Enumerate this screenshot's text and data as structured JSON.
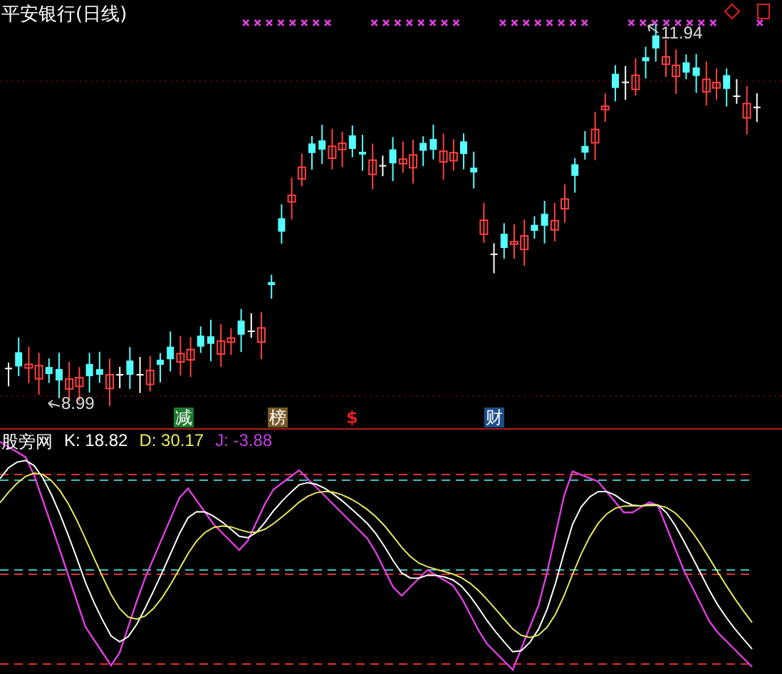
{
  "chart_title": "平安银行(日线)",
  "high_label": "11.94",
  "low_label": "8.99",
  "signals": [
    {
      "text": "减",
      "kind": "badge",
      "color": "#1e7a2e"
    },
    {
      "text": "榜",
      "kind": "badge",
      "color": "#7a5a2a"
    },
    {
      "text": "$",
      "kind": "mark",
      "color": "#e02020"
    },
    {
      "text": "财",
      "kind": "badge",
      "color": "#1e4e8a"
    }
  ],
  "indicator": {
    "name": "股旁网",
    "k": "K: 18.82",
    "d": "D: 30.17",
    "j": "J: -3.88"
  }
}
